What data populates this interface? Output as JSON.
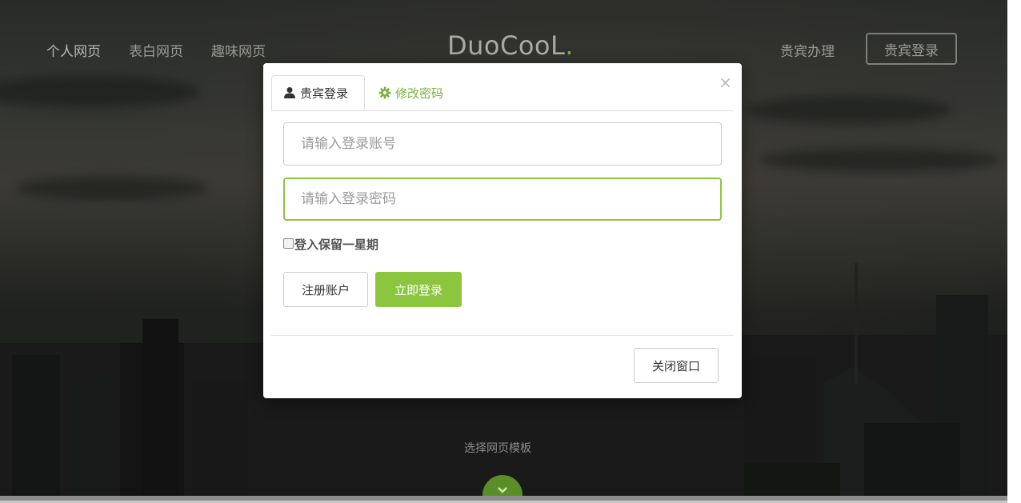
{
  "nav": {
    "left_links": [
      "个人网页",
      "表白网页",
      "趣味网页"
    ],
    "logo_text": "DuoCooL",
    "logo_dot": ".",
    "right_link": "贵宾办理",
    "right_button": "贵宾登录"
  },
  "page": {
    "template_text": "选择网页模板"
  },
  "modal": {
    "close_glyph": "×",
    "tabs": [
      {
        "label": "贵宾登录",
        "icon": "user-icon",
        "active": true
      },
      {
        "label": "修改密码",
        "icon": "gear-icon",
        "active": false
      }
    ],
    "account_placeholder": "请输入登录账号",
    "password_placeholder": "请输入登录密码",
    "remember_label": "登入保留一星期",
    "register_button": "注册账户",
    "login_button": "立即登录",
    "close_window_button": "关闭窗口"
  },
  "colors": {
    "accent_green": "#8cc63f",
    "logo_dot_green": "#7ab33d"
  }
}
